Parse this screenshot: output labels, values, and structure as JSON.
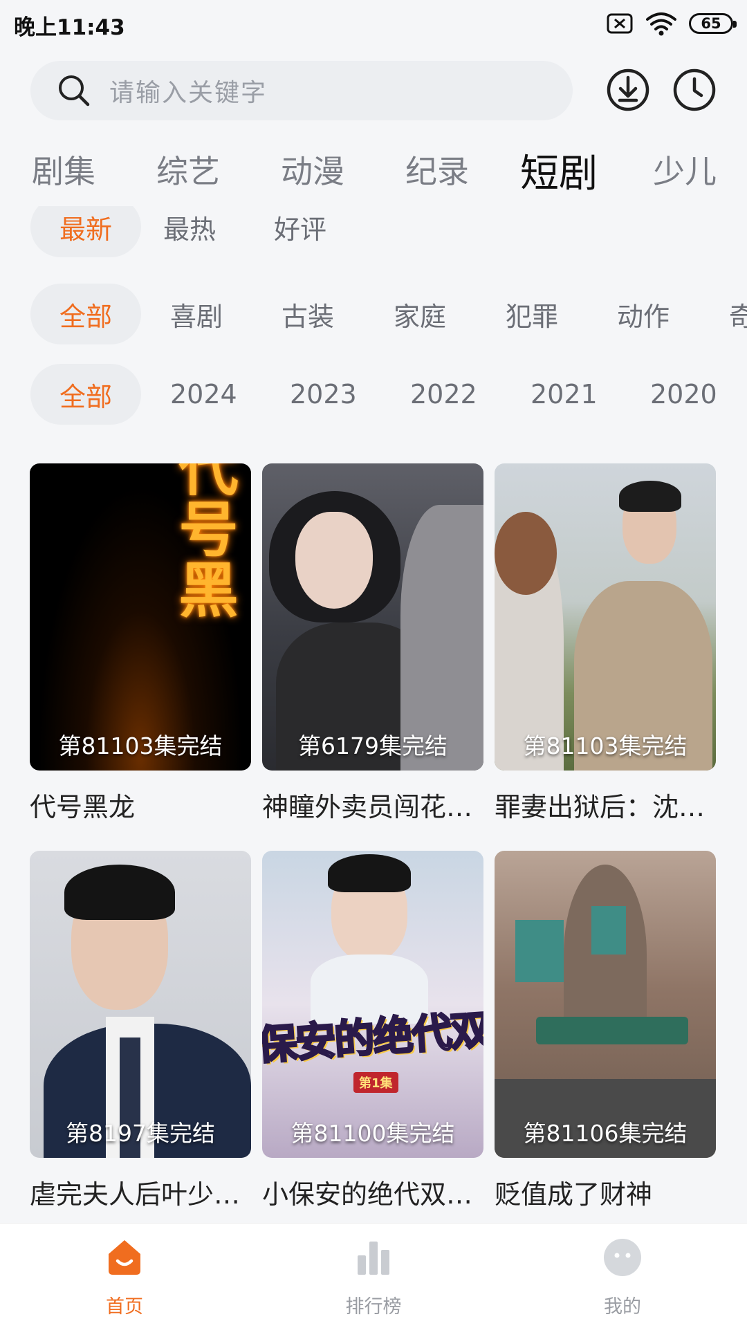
{
  "status_bar": {
    "time": "晚上11:43",
    "battery": "65"
  },
  "search": {
    "placeholder": "请输入关键字"
  },
  "category_tabs": [
    "剧集",
    "综艺",
    "动漫",
    "纪录",
    "短剧",
    "少儿"
  ],
  "active_category": "短剧",
  "sort_filters": [
    "最新",
    "最热",
    "好评"
  ],
  "genre_filters": [
    "全部",
    "喜剧",
    "古装",
    "家庭",
    "犯罪",
    "动作",
    "奇"
  ],
  "year_filters": [
    "全部",
    "2024",
    "2023",
    "2022",
    "2021",
    "2020"
  ],
  "cards": [
    {
      "title": "代号黑龙",
      "badge": "第81103集完结",
      "poster_text": "代号黑"
    },
    {
      "title": "神瞳外卖员闯花…",
      "badge": "第6179集完结"
    },
    {
      "title": "罪妻出狱后：沈…",
      "badge": "第81103集完结"
    },
    {
      "title": "虐完夫人后叶少…",
      "badge": "第8197集完结"
    },
    {
      "title": "小保安的绝代双…",
      "badge": "第81100集完结",
      "poster_text": "小保安的绝代双娇",
      "poster_tag": "第1集"
    },
    {
      "title": "贬值成了财神",
      "badge": "第81106集完结"
    }
  ],
  "bottom_nav": [
    {
      "label": "首页",
      "icon": "home-icon",
      "active": true
    },
    {
      "label": "排行榜",
      "icon": "ranking-icon",
      "active": false
    },
    {
      "label": "我的",
      "icon": "profile-icon",
      "active": false
    }
  ],
  "colors": {
    "accent": "#f06d1f",
    "background": "#f5f6f8"
  }
}
